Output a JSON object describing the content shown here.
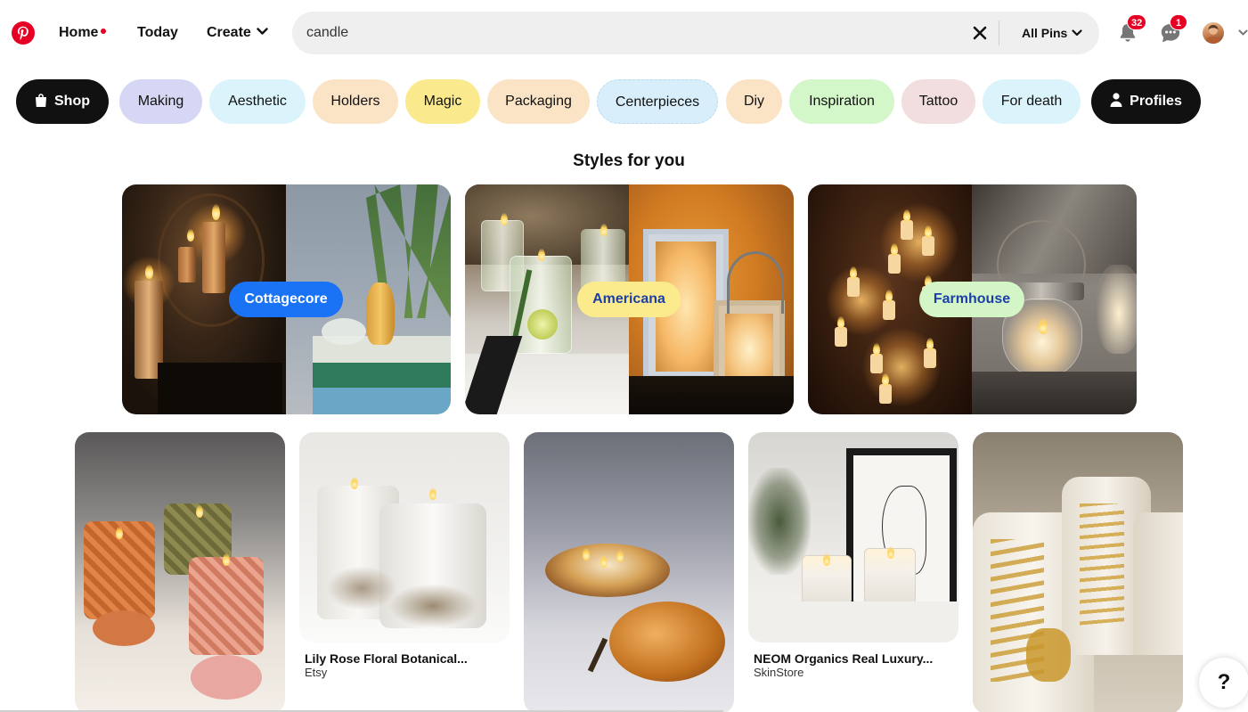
{
  "header": {
    "nav": {
      "home": "Home",
      "today": "Today",
      "create": "Create"
    },
    "search": {
      "value": "candle",
      "filter": "All Pins"
    },
    "notifications_count": "32",
    "messages_count": "1"
  },
  "chips": [
    {
      "label": "Shop",
      "icon": "shopping-bag-icon",
      "color": "#111111"
    },
    {
      "label": "Making",
      "color": "#d6d6f5"
    },
    {
      "label": "Aesthetic",
      "color": "#dbf4fb"
    },
    {
      "label": "Holders",
      "color": "#fbe4c6"
    },
    {
      "label": "Magic",
      "color": "#fbea8d"
    },
    {
      "label": "Packaging",
      "color": "#fbe4c6"
    },
    {
      "label": "Centerpieces",
      "color": "#d9eefb"
    },
    {
      "label": "Diy",
      "color": "#fbe4c6"
    },
    {
      "label": "Inspiration",
      "color": "#d3f7c9"
    },
    {
      "label": "Tattoo",
      "color": "#f2dede"
    },
    {
      "label": "For death",
      "color": "#dbf4fb"
    },
    {
      "label": "Profiles",
      "icon": "person-icon",
      "color": "#111111"
    }
  ],
  "styles_section": {
    "title": "Styles for you",
    "cards": [
      {
        "label": "Cottagecore",
        "pill_color": "#1a73f5",
        "text_color": "#ffffff"
      },
      {
        "label": "Americana",
        "pill_color": "#fbeb8c",
        "text_color": "#1d3fa8"
      },
      {
        "label": "Farmhouse",
        "pill_color": "#d4f5c5",
        "text_color": "#1d3fa8"
      }
    ]
  },
  "pins": [
    {
      "title": "",
      "source": ""
    },
    {
      "title": "Lily Rose Floral Botanical...",
      "source": "Etsy"
    },
    {
      "title": "",
      "source": ""
    },
    {
      "title": "NEOM Organics Real Luxury...",
      "source": "SkinStore"
    },
    {
      "title": "",
      "source": ""
    }
  ],
  "help_button": "?",
  "colors": {
    "brand": "#e60023",
    "text": "#111111",
    "search_bg": "#efefef"
  }
}
